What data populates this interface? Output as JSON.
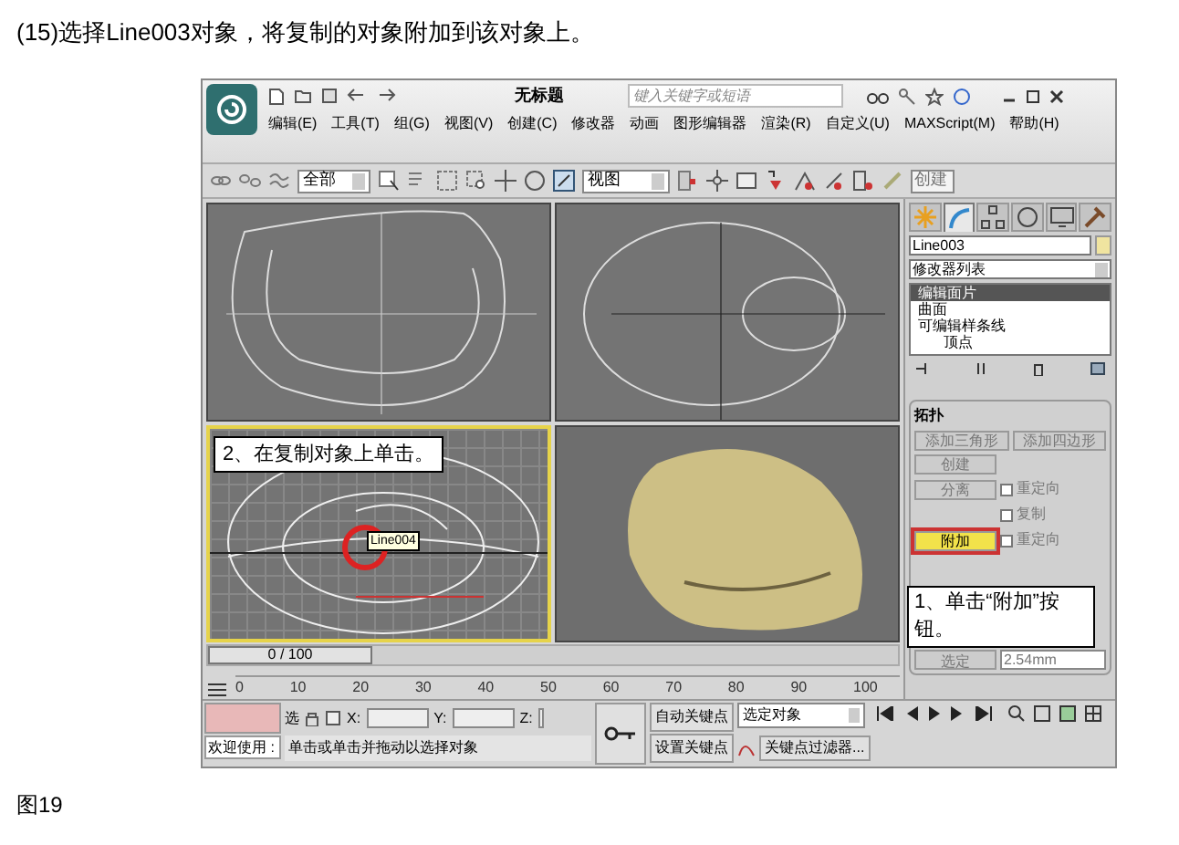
{
  "caption": "(15)选择Line003对象，将复制的对象附加到该对象上。",
  "window": {
    "title": "无标题",
    "search": {
      "placeholder": "键入关键字或短语"
    }
  },
  "menu": [
    "编辑(E)",
    "工具(T)",
    "组(G)",
    "视图(V)",
    "创建(C)",
    "修改器",
    "动画",
    "图形编辑器",
    "渲染(R)",
    "自定义(U)",
    "MAXScript(M)",
    "帮助(H)"
  ],
  "toolbar": {
    "selection_filter": "全部",
    "reference_coordinate": "视图",
    "named_selection": "创建"
  },
  "viewports": {
    "callout": "2、在复制对象上单击。",
    "tooltip": "Line004"
  },
  "command_panel": {
    "tabs": [
      {
        "kind": "create",
        "selected": false
      },
      {
        "kind": "modify",
        "selected": true
      },
      {
        "kind": "hierarchy",
        "selected": false
      },
      {
        "kind": "motion",
        "selected": false
      },
      {
        "kind": "display",
        "selected": false
      },
      {
        "kind": "utilities",
        "selected": false
      }
    ],
    "object_name": "Line003",
    "modifier_list": "修改器列表",
    "stack": [
      {
        "label": "编辑面片",
        "selected": true
      },
      {
        "label": "曲面",
        "selected": false
      },
      {
        "label": "可编辑样条线",
        "selected": false,
        "children": [
          {
            "label": "顶点",
            "selected": false
          }
        ]
      }
    ],
    "rollout": {
      "title": "拓扑",
      "buttons": [
        {
          "label": "添加三角形",
          "active": false
        },
        {
          "label": "添加四边形",
          "active": false
        },
        {
          "label": "创建",
          "active": false
        },
        {
          "label": "分离",
          "active": false
        },
        {
          "label": "附加",
          "active": true
        }
      ],
      "checkboxes": [
        {
          "label": "重定向",
          "checked": false
        },
        {
          "label": "复制",
          "checked": false
        },
        {
          "label": "重定向",
          "checked": false
        }
      ],
      "weld_button": "选定",
      "threshold": "2.54mm"
    },
    "callout": "1、单击“附加”按钮。"
  },
  "time_slider": {
    "label": "0 / 100",
    "level": 0
  },
  "ruler": [
    "0",
    "10",
    "20",
    "30",
    "40",
    "50",
    "60",
    "70",
    "80",
    "90",
    "100"
  ],
  "status_bar": {
    "welcome": "欢迎使用 :",
    "selection_label": "选",
    "x_label": "X:",
    "y_label": "Y:",
    "z_label": "Z:",
    "prompt": "单击或单击并拖动以选择对象",
    "auto_key": "自动关键点",
    "set_key": "设置关键点",
    "key_mode": "选定对象",
    "key_filters": "关键点过滤器..."
  },
  "figure_label": "图19"
}
